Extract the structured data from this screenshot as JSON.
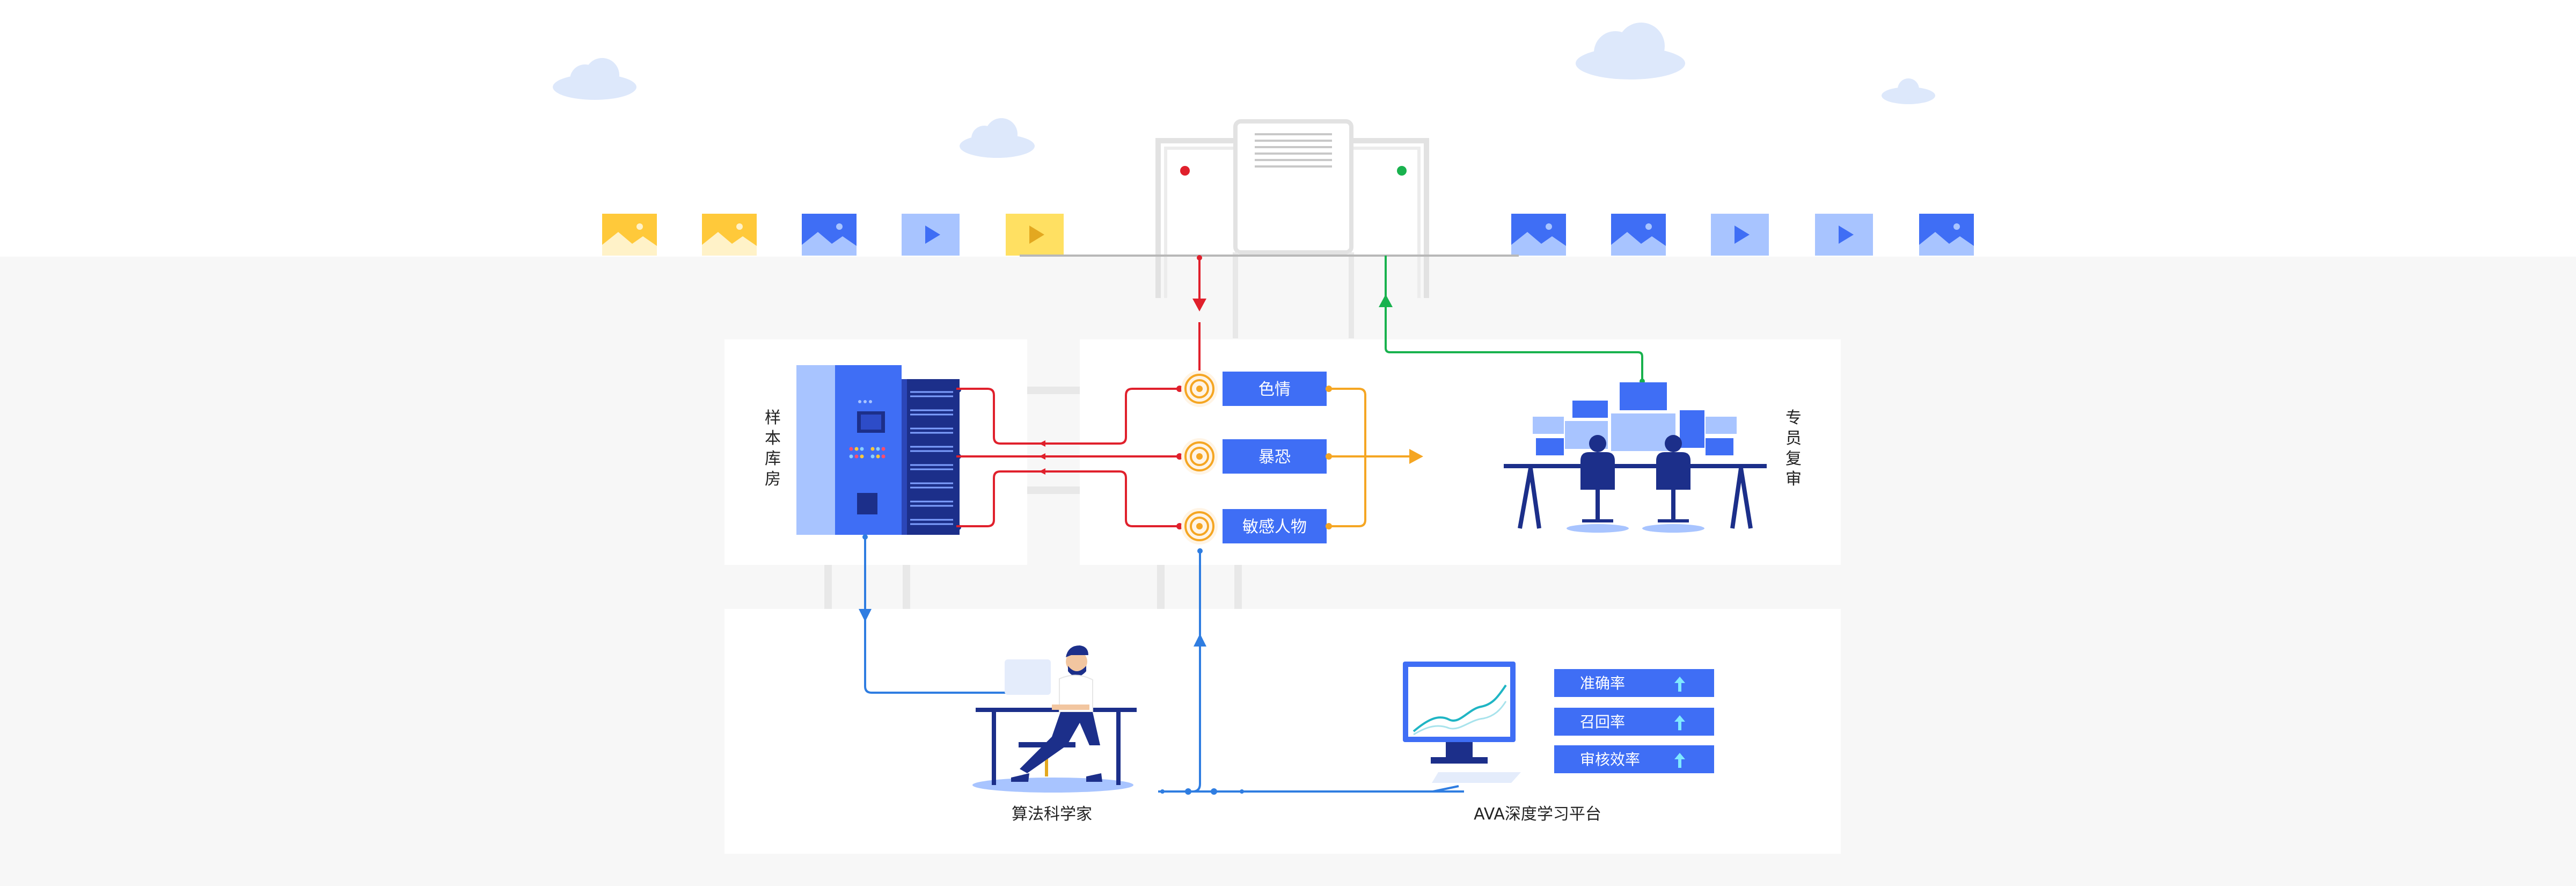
{
  "sample_room": {
    "label": "样本库房"
  },
  "categories": [
    {
      "label": "色情"
    },
    {
      "label": "暴恐"
    },
    {
      "label": "敏感人物"
    }
  ],
  "review": {
    "label": "专员复审"
  },
  "scientist": {
    "label": "算法科学家"
  },
  "platform": {
    "label": "AVA深度学习平台"
  },
  "metrics": [
    {
      "label": "准确率"
    },
    {
      "label": "召回率"
    },
    {
      "label": "审核效率"
    }
  ],
  "colors": {
    "brand_blue": "#3f6ef5",
    "dark_blue": "#1c2f8a",
    "red_flow": "#e0202c",
    "green_flow": "#19b24e",
    "orange_flow": "#f5a623",
    "light_blue": "#a8c4ff",
    "yellow": "#ffc93a"
  }
}
